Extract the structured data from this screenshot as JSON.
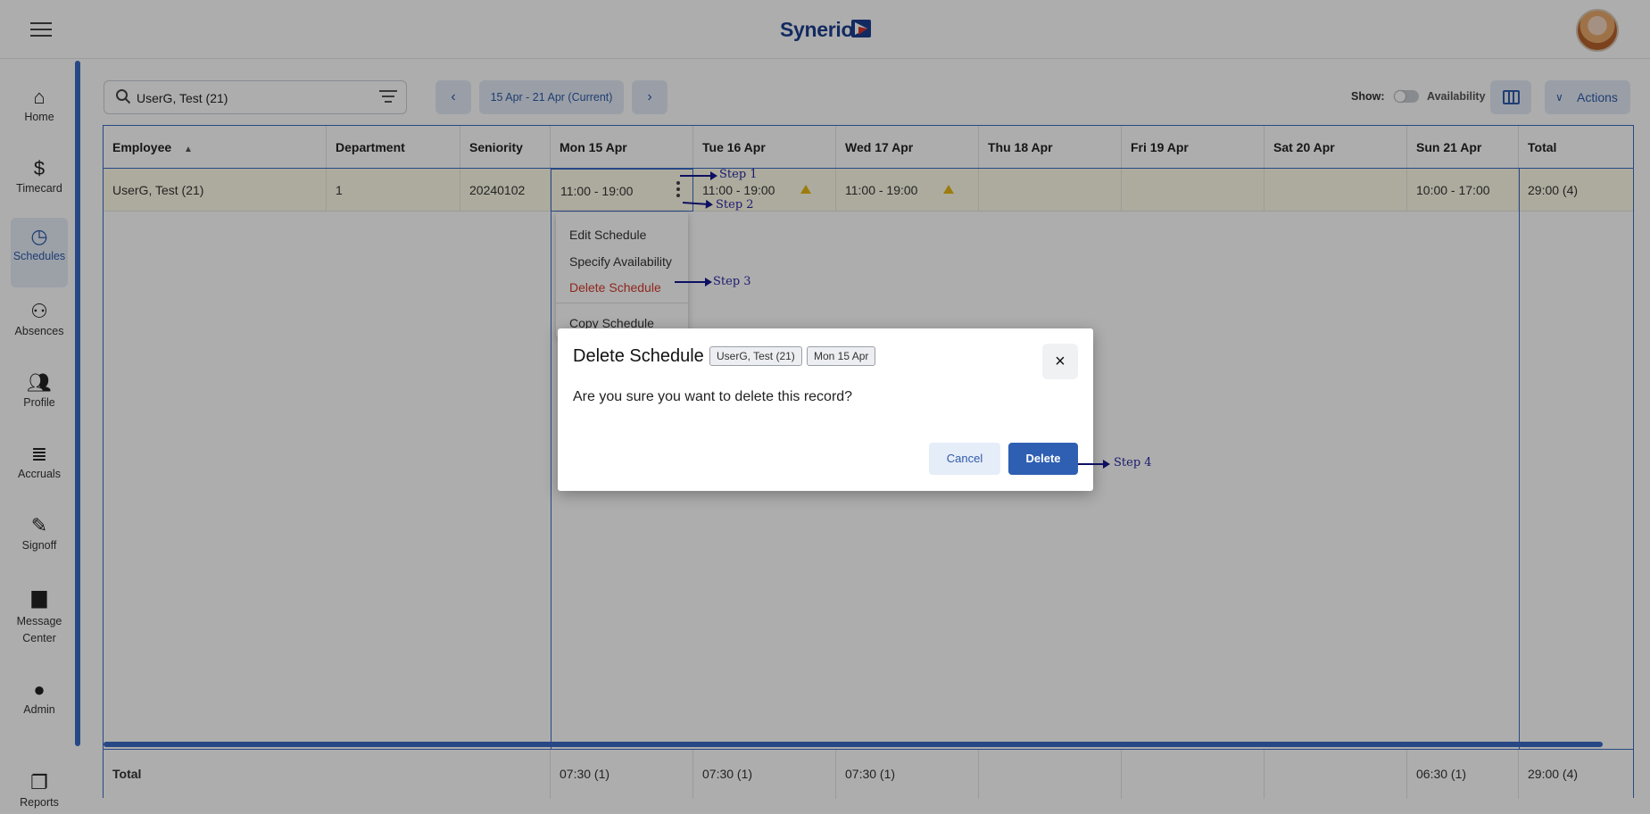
{
  "app": {
    "brand": "Synerion"
  },
  "sidebar": {
    "items": [
      {
        "label": "Home",
        "icon": "home-icon"
      },
      {
        "label": "Timecard",
        "icon": "dollar-icon"
      },
      {
        "label": "Schedules",
        "icon": "clock-icon",
        "active": true
      },
      {
        "label": "Absences",
        "icon": "person-x-icon"
      },
      {
        "label": "Profile",
        "icon": "people-icon"
      },
      {
        "label": "Accruals",
        "icon": "list-icon"
      },
      {
        "label": "Signoff",
        "icon": "edit-icon"
      },
      {
        "label": "Message",
        "label2": "Center",
        "icon": "chat-icon"
      },
      {
        "label": "Admin",
        "icon": "person-icon"
      },
      {
        "label": "Reports",
        "icon": "document-icon"
      }
    ]
  },
  "toolbar": {
    "search_value": "UserG, Test (21)",
    "prev": "‹",
    "date_range": "15 Apr - 21 Apr (Current)",
    "next": "›",
    "show_label": "Show:",
    "availability_label": "Availability",
    "actions_label": "Actions"
  },
  "grid": {
    "headers": [
      "Employee",
      "Department",
      "Seniority",
      "Mon 15 Apr",
      "Tue 16 Apr",
      "Wed 17 Apr",
      "Thu 18 Apr",
      "Fri 19 Apr",
      "Sat 20 Apr",
      "Sun 21 Apr",
      "Total"
    ],
    "sort_indicator": "▲",
    "row": {
      "employee": "UserG, Test (21)",
      "department": "1",
      "seniority": "20240102",
      "mon": "11:00 - 19:00",
      "tue": "11:00 - 19:00",
      "wed": "11:00 - 19:00",
      "thu": "",
      "fri": "",
      "sat": "",
      "sun": "10:00 - 17:00",
      "total": "29:00 (4)"
    },
    "totals": {
      "label": "Total",
      "mon": "07:30 (1)",
      "tue": "07:30 (1)",
      "wed": "07:30 (1)",
      "sun": "06:30 (1)",
      "total": "29:00 (4)"
    }
  },
  "context_menu": {
    "items": [
      "Edit Schedule",
      "Specify Availability",
      "Delete Schedule",
      "Copy Schedule"
    ]
  },
  "dialog": {
    "title": "Delete Schedule",
    "chip_employee": "UserG, Test (21)",
    "chip_date": "Mon 15 Apr",
    "close": "×",
    "message": "Are you sure you want to delete this record?",
    "cancel_label": "Cancel",
    "delete_label": "Delete"
  },
  "annotations": {
    "step1": "Step 1",
    "step2": "Step 2",
    "step3": "Step 3",
    "step4": "Step 4"
  },
  "colors": {
    "accent": "#2f5fb3",
    "danger": "#d33a2c",
    "warning": "#e8b714",
    "row_highlight": "#fffde9"
  }
}
